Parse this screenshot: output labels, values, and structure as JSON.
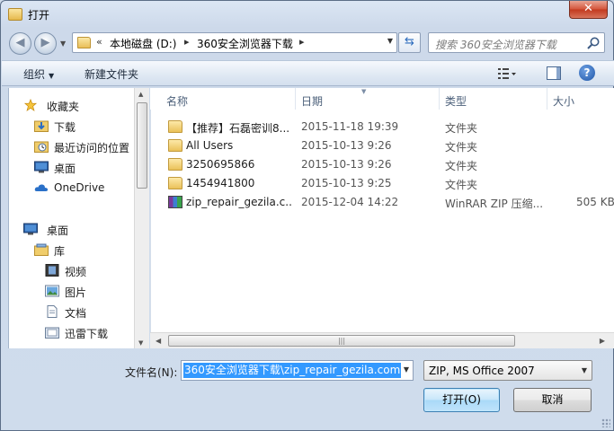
{
  "window": {
    "title": "打开"
  },
  "address": {
    "prefix": "«",
    "crumbs": [
      "本地磁盘 (D:)",
      "360安全浏览器下载"
    ]
  },
  "search": {
    "placeholder": "搜索 360安全浏览器下载"
  },
  "toolbar": {
    "organize": "组织",
    "new_folder": "新建文件夹"
  },
  "nav": {
    "favorites": "收藏夹",
    "downloads": "下载",
    "recent": "最近访问的位置",
    "desktop_fav": "桌面",
    "onedrive": "OneDrive",
    "desktop": "桌面",
    "libraries": "库",
    "videos": "视频",
    "pictures": "图片",
    "documents": "文档",
    "xunlei": "迅雷下载"
  },
  "columns": {
    "name": "名称",
    "date": "日期",
    "type": "类型",
    "size": "大小"
  },
  "files": [
    {
      "name": "【推荐】石磊密训8...",
      "date": "2015-11-18 19:39",
      "type": "文件夹",
      "size": "",
      "icon": "folder-icon"
    },
    {
      "name": "All Users",
      "date": "2015-10-13 9:26",
      "type": "文件夹",
      "size": "",
      "icon": "folder-icon"
    },
    {
      "name": "3250695866",
      "date": "2015-10-13 9:26",
      "type": "文件夹",
      "size": "",
      "icon": "folder-icon"
    },
    {
      "name": "1454941800",
      "date": "2015-10-13 9:25",
      "type": "文件夹",
      "size": "",
      "icon": "folder-icon"
    },
    {
      "name": "zip_repair_gezila.c...",
      "date": "2015-12-04 14:22",
      "type": "WinRAR ZIP 压缩...",
      "size": "505 KB",
      "icon": "zip-archive-icon"
    }
  ],
  "bottom": {
    "filename_label": "文件名(N):",
    "filename_value": "360安全浏览器下载\\zip_repair_gezila.com",
    "filter_value": "ZIP, MS Office 2007",
    "open_label": "打开(O)",
    "cancel_label": "取消"
  },
  "colors": {
    "selection": "#3399ff",
    "window_frame": "#cfdcec",
    "close_button": "#c2391e"
  }
}
